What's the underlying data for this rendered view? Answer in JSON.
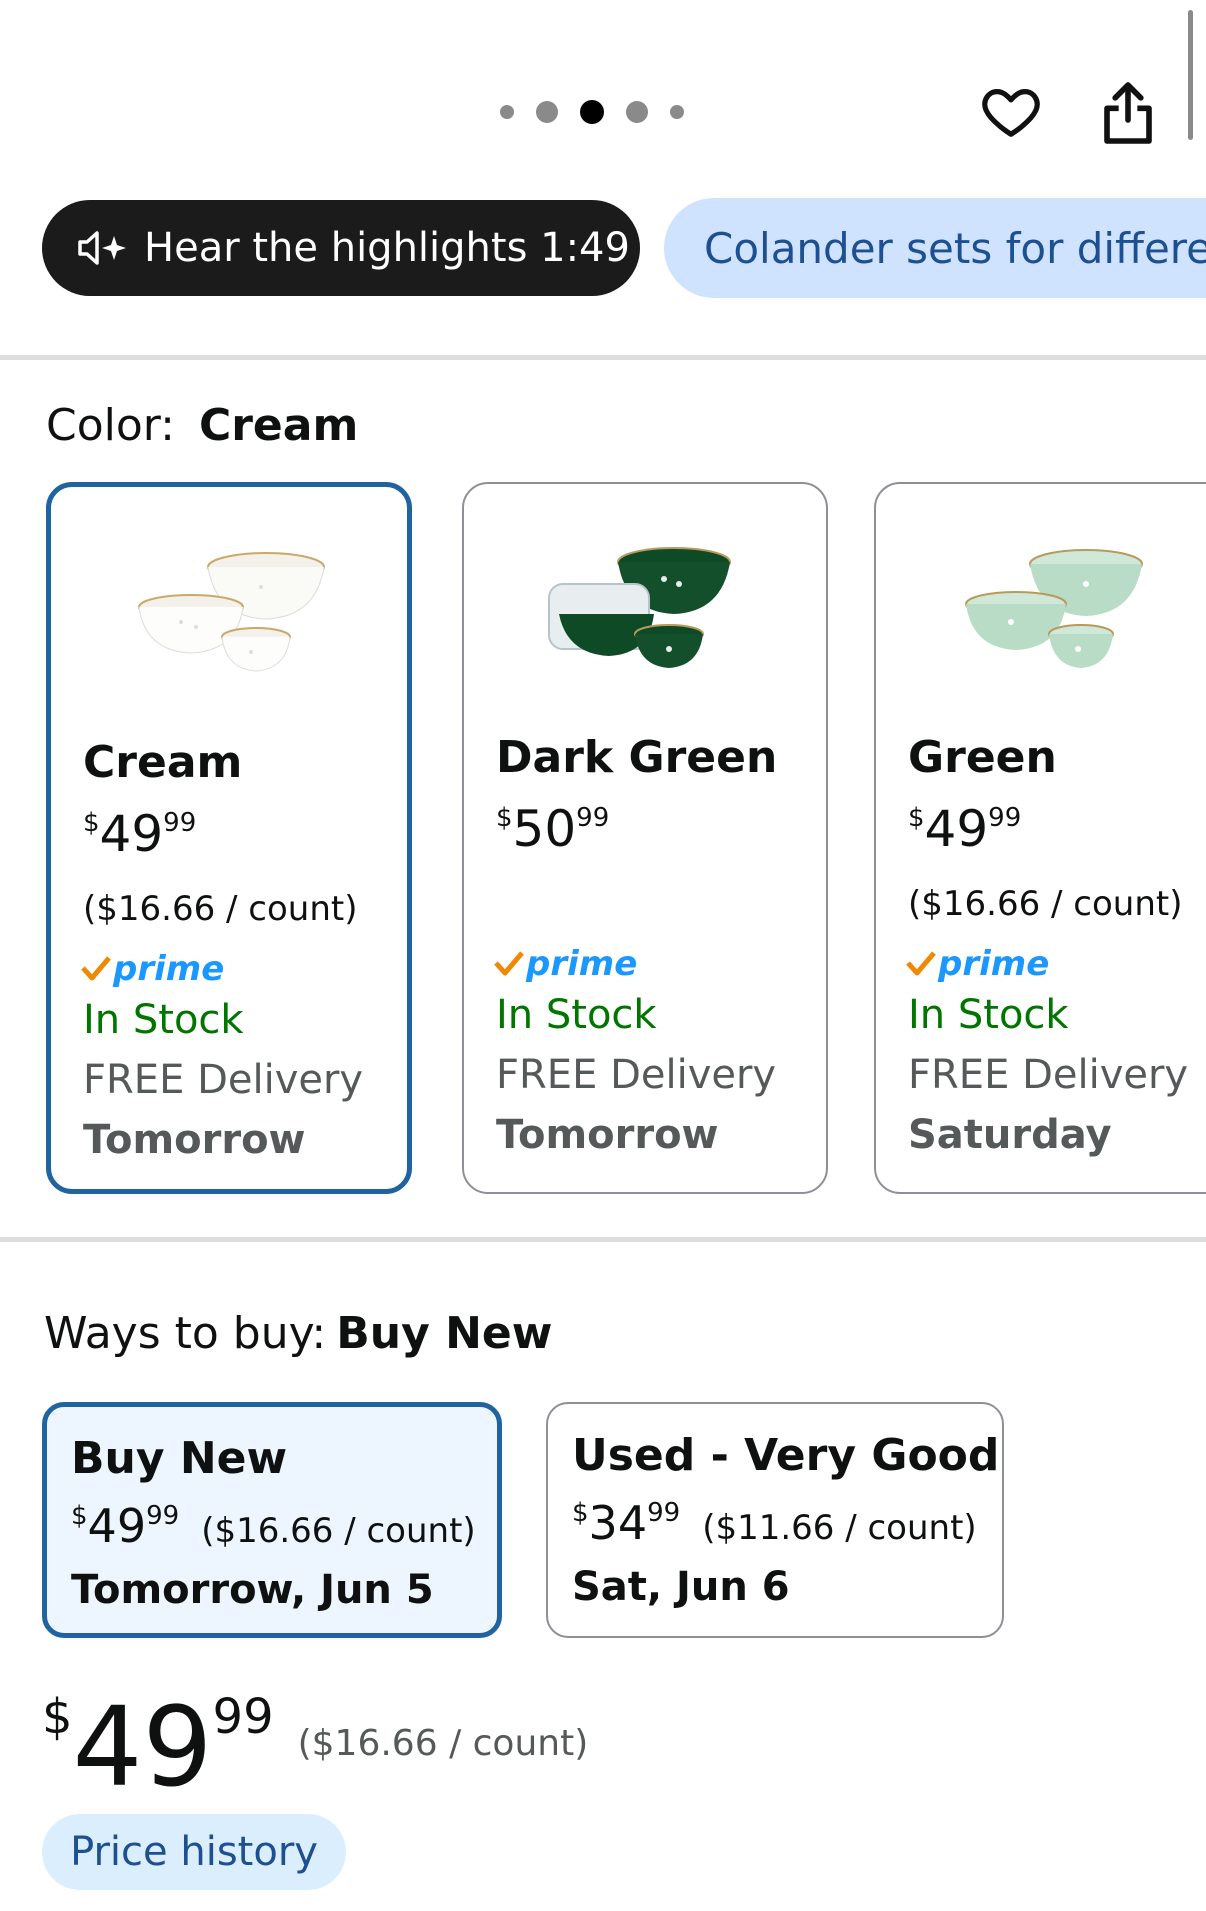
{
  "carousel": {
    "total": 5,
    "active_index": 2
  },
  "icons": {
    "heart": "heart-outline-icon",
    "share": "share-icon",
    "audio": "speaker-sparkle-icon"
  },
  "pills": {
    "highlights": "Hear the highlights 1:49",
    "topic": "Colander sets for different"
  },
  "color": {
    "label": "Color:",
    "selected": "Cream"
  },
  "swatches": [
    {
      "name": "Cream",
      "price_dollars": "49",
      "price_cents": "99",
      "price_symbol": "$",
      "unit_price": "($16.66 / count)",
      "prime": "prime",
      "stock": "In Stock",
      "delivery": "FREE Delivery",
      "day": "Tomorrow"
    },
    {
      "name": "Dark Green",
      "price_dollars": "50",
      "price_cents": "99",
      "price_symbol": "$",
      "unit_price": "",
      "prime": "prime",
      "stock": "In Stock",
      "delivery": "FREE Delivery",
      "day": "Tomorrow"
    },
    {
      "name": "Green",
      "price_dollars": "49",
      "price_cents": "99",
      "price_symbol": "$",
      "unit_price": "($16.66 / count)",
      "prime": "prime",
      "stock": "In Stock",
      "delivery": "FREE Delivery",
      "day": "Saturday"
    }
  ],
  "ways": {
    "label": "Ways to buy:",
    "selected": "Buy New"
  },
  "buy_options": [
    {
      "title": "Buy New",
      "symbol": "$",
      "dollars": "49",
      "cents": "99",
      "unit": "($16.66 / count)",
      "date": "Tomorrow, Jun 5"
    },
    {
      "title": "Used - Very Good",
      "symbol": "$",
      "dollars": "34",
      "cents": "99",
      "unit": "($11.66 / count)",
      "date": "Sat, Jun 6"
    }
  ],
  "main_price": {
    "symbol": "$",
    "dollars": "49",
    "cents": "99",
    "unit": "($16.66 / count)"
  },
  "price_history": "Price history",
  "colors": {
    "selected_border": "#2162a1",
    "in_stock": "#007600",
    "prime": "#1a98ff",
    "pill_blue": "#cfe3ff"
  }
}
